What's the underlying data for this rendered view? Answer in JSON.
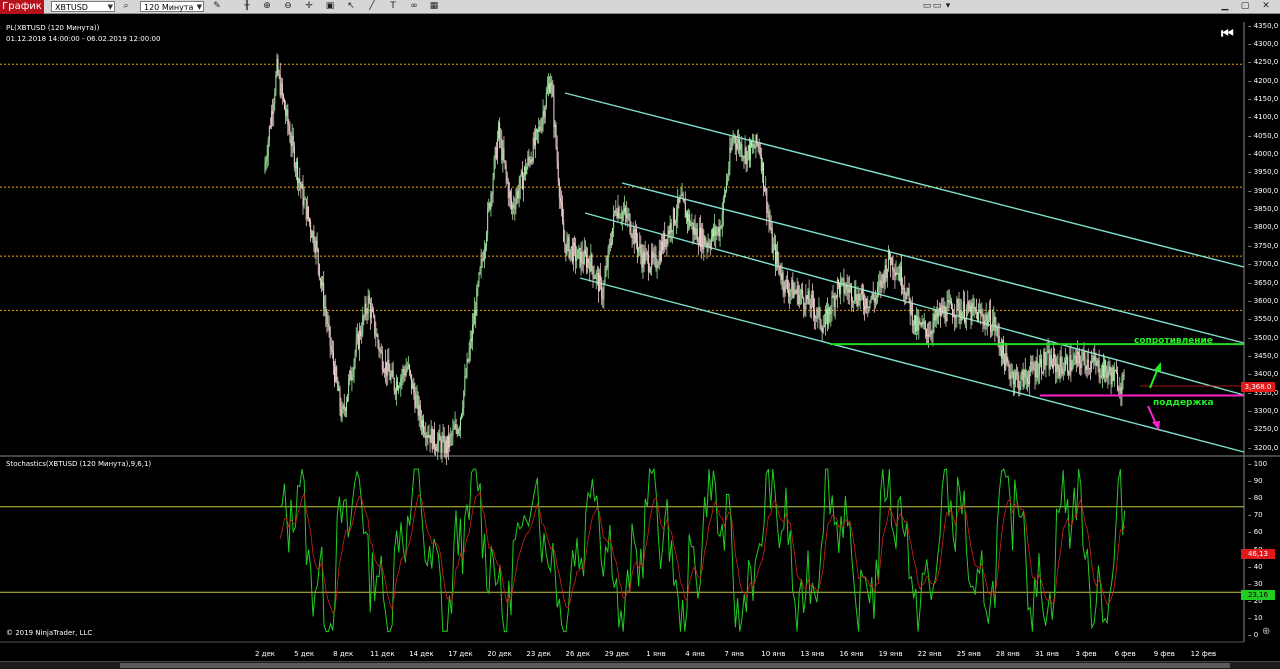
{
  "toolbar": {
    "tab_label": "График",
    "instrument": "XBTUSD",
    "period": "120 Минута"
  },
  "price_panel": {
    "title": "PL(XBTUSD (120 Минута))",
    "range": "01.12.2018 14:00:00 - 06.02.2019 12:00:00",
    "current_price_badge": "3,368.0",
    "annotation_resistance": "сопротивление",
    "annotation_support": "поддержка"
  },
  "stoch_panel": {
    "title": "Stochastics(XBTUSD (120 Минута),9,6,1)",
    "badge_d": "46,13",
    "badge_k": "23,16"
  },
  "copyright": "© 2019 NinjaTrader, LLC",
  "colors": {
    "tab": "#b5121b",
    "channel": "#7fe0d0",
    "resistance": "#22dd22",
    "support": "#ff22cc",
    "hline": "#f0a000",
    "stoch_k": "#22cc22",
    "stoch_d": "#cc2222",
    "stoch_level": "#c8c840"
  },
  "chart_data": [
    {
      "type": "candlestick",
      "title": "PL(XBTUSD (120 Минута))",
      "ylim": [
        3180,
        4360
      ],
      "y_ticks": [
        3200,
        3250,
        3300,
        3350,
        3400,
        3450,
        3500,
        3550,
        3600,
        3650,
        3700,
        3750,
        3800,
        3850,
        3900,
        3950,
        4000,
        4050,
        4100,
        4150,
        4200,
        4250,
        4300,
        4350
      ],
      "x_ticks": [
        "2 дек",
        "5 дек",
        "8 дек",
        "11 дек",
        "14 дек",
        "17 дек",
        "20 дек",
        "23 дек",
        "26 дек",
        "29 дек",
        "1 янв",
        "4 янв",
        "7 янв",
        "10 янв",
        "13 янв",
        "16 янв",
        "19 янв",
        "22 янв",
        "25 янв",
        "28 янв",
        "31 янв",
        "3 фев",
        "6 фев",
        "9 фев",
        "12 фев"
      ],
      "horizontal_levels": [
        4245,
        3910,
        3722,
        3574
      ],
      "resistance_level": 3482,
      "support_level": 3342,
      "current_price": 3368,
      "price_path": [
        [
          "2 дек",
          3950
        ],
        [
          "3 дек",
          4230
        ],
        [
          "4 дек",
          4050
        ],
        [
          "5 дек",
          3880
        ],
        [
          "6 дек",
          3750
        ],
        [
          "7 дек",
          3500
        ],
        [
          "8 дек",
          3280
        ],
        [
          "9 дек",
          3460
        ],
        [
          "10 дек",
          3600
        ],
        [
          "11 дек",
          3450
        ],
        [
          "12 дек",
          3370
        ],
        [
          "13 дек",
          3420
        ],
        [
          "14 дек",
          3280
        ],
        [
          "15 дек",
          3220
        ],
        [
          "16 дек",
          3200
        ],
        [
          "17 дек",
          3270
        ],
        [
          "18 дек",
          3520
        ],
        [
          "19 дек",
          3780
        ],
        [
          "20 дек",
          4060
        ],
        [
          "21 дек",
          3850
        ],
        [
          "22 дек",
          3950
        ],
        [
          "23 дек",
          4050
        ],
        [
          "24 дек",
          4210
        ],
        [
          "25 дек",
          3760
        ],
        [
          "26 дек",
          3720
        ],
        [
          "27 дек",
          3710
        ],
        [
          "28 дек",
          3620
        ],
        [
          "29 дек",
          3860
        ],
        [
          "30 дек",
          3820
        ],
        [
          "31 дек",
          3720
        ],
        [
          "1 янв",
          3700
        ],
        [
          "2 янв",
          3790
        ],
        [
          "3 янв",
          3870
        ],
        [
          "4 янв",
          3790
        ],
        [
          "5 янв",
          3760
        ],
        [
          "6 янв",
          3800
        ],
        [
          "7 янв",
          4050
        ],
        [
          "8 янв",
          4000
        ],
        [
          "9 янв",
          4030
        ],
        [
          "10 янв",
          3750
        ],
        [
          "11 янв",
          3640
        ],
        [
          "12 янв",
          3620
        ],
        [
          "13 янв",
          3590
        ],
        [
          "14 янв",
          3530
        ],
        [
          "15 янв",
          3640
        ],
        [
          "16 янв",
          3630
        ],
        [
          "17 янв",
          3600
        ],
        [
          "18 янв",
          3610
        ],
        [
          "19 янв",
          3720
        ],
        [
          "20 янв",
          3660
        ],
        [
          "21 янв",
          3530
        ],
        [
          "22 янв",
          3520
        ],
        [
          "23 янв",
          3570
        ],
        [
          "24 янв",
          3580
        ],
        [
          "25 янв",
          3570
        ],
        [
          "26 янв",
          3560
        ],
        [
          "27 янв",
          3540
        ],
        [
          "28 янв",
          3420
        ],
        [
          "29 янв",
          3380
        ],
        [
          "30 янв",
          3410
        ],
        [
          "31 янв",
          3440
        ],
        [
          "1 фев",
          3420
        ],
        [
          "2 фев",
          3430
        ],
        [
          "3 фев",
          3440
        ],
        [
          "4 фев",
          3420
        ],
        [
          "5 фев",
          3400
        ],
        [
          "6 фев",
          3368
        ]
      ]
    },
    {
      "type": "line",
      "title": "Stochastics(XBTUSD (120 Минута),9,6,1)",
      "ylim": [
        0,
        100
      ],
      "y_ticks": [
        0,
        10,
        20,
        30,
        40,
        50,
        60,
        70,
        80,
        90,
        100
      ],
      "levels": [
        75,
        25
      ],
      "series": [
        {
          "name": "K",
          "last": 23.16
        },
        {
          "name": "D",
          "last": 46.13
        }
      ]
    }
  ]
}
